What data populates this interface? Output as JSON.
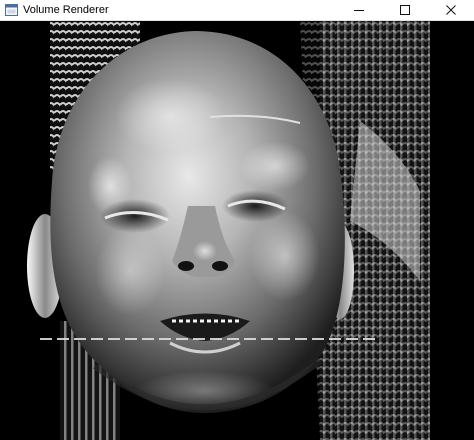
{
  "window": {
    "title": "Volume Renderer",
    "icon": "app-window-icon",
    "controls": {
      "minimize_icon": "minimize-icon",
      "maximize_icon": "maximize-icon",
      "close_icon": "close-icon"
    }
  },
  "colors": {
    "titlebar_bg": "#ffffff",
    "viewport_bg": "#000000"
  }
}
